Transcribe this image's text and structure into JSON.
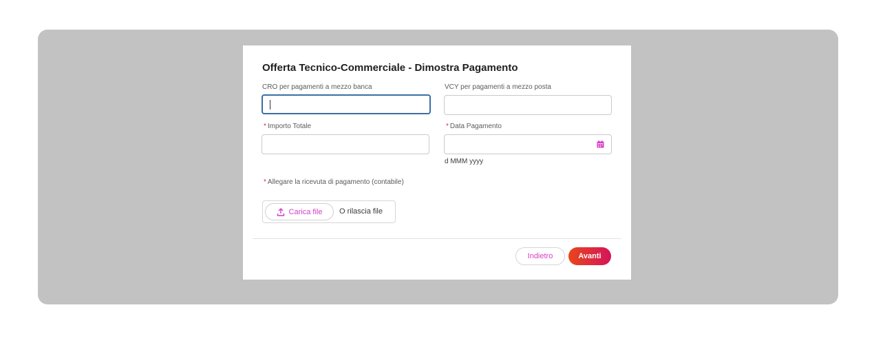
{
  "modal": {
    "title": "Offerta Tecnico-Commerciale - Dimostra Pagamento"
  },
  "fields": {
    "cro": {
      "label": "CRO per pagamenti a mezzo banca",
      "value": "",
      "required": false
    },
    "vcy": {
      "label": "VCY per pagamenti a mezzo posta",
      "value": "",
      "required": false
    },
    "importo": {
      "required_marker": "*",
      "label": "Importo Totale",
      "value": "",
      "required": true
    },
    "data_pagamento": {
      "required_marker": "*",
      "label": "Data Pagamento",
      "value": "",
      "hint": "d MMM yyyy",
      "icon": "calendar-icon",
      "required": true
    }
  },
  "upload": {
    "required_marker": "*",
    "label": "Allegare la ricevuta di pagamento (contabile)",
    "button_label": "Carica file",
    "button_icon": "upload-icon",
    "drop_label": "O rilascia file"
  },
  "footer": {
    "back_label": "Indietro",
    "next_label": "Avanti"
  },
  "colors": {
    "accent_pink": "#d63cc8",
    "required_red": "#e0245e",
    "focus_blue": "#3a6ea5",
    "primary_gradient_start": "#e8461b",
    "primary_gradient_end": "#d4145a",
    "overlay_gray": "#c2c2c2"
  }
}
